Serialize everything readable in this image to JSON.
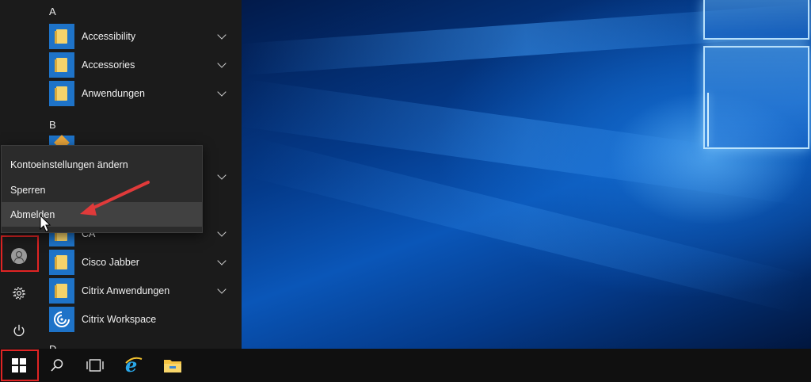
{
  "start_menu": {
    "letters": [
      "A",
      "B",
      "D"
    ],
    "apps": [
      {
        "label": "Accessibility",
        "icon": "folder-icon",
        "expandable": true
      },
      {
        "label": "Accessories",
        "icon": "folder-icon",
        "expandable": true
      },
      {
        "label": "Anwendungen",
        "icon": "folder-icon",
        "expandable": true
      },
      {
        "label": "CA",
        "icon": "folder-icon",
        "expandable": true
      },
      {
        "label": "Cisco Jabber",
        "icon": "folder-icon",
        "expandable": true
      },
      {
        "label": "Citrix Anwendungen",
        "icon": "folder-icon",
        "expandable": true
      },
      {
        "label": "Citrix Workspace",
        "icon": "citrix-workspace-icon",
        "expandable": false
      }
    ],
    "rail": {
      "user_icon": "user-avatar-icon",
      "settings_icon": "gear-icon",
      "power_icon": "power-icon"
    }
  },
  "context_menu": {
    "items": [
      "Kontoeinstellungen ändern",
      "Sperren",
      "Abmelden"
    ],
    "hovered": "Abmelden"
  },
  "annotations": {
    "highlight_color": "#e02424",
    "arrow_color": "#e03a3a"
  },
  "taskbar": {
    "icons": [
      "windows-start-icon",
      "search-icon",
      "task-view-icon",
      "internet-explorer-icon",
      "file-explorer-icon"
    ]
  },
  "colors": {
    "tile_blue": "#1e73c8",
    "menu_bg": "#1b1b1b",
    "taskbar_bg": "#101010"
  }
}
